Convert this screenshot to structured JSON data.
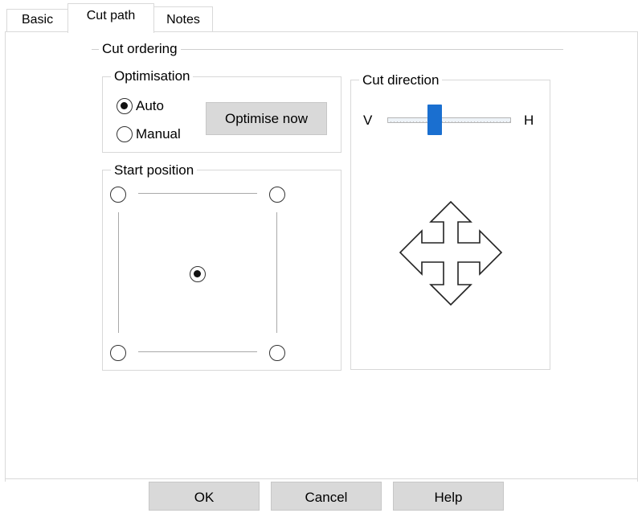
{
  "tabs": [
    {
      "label": "Basic"
    },
    {
      "label": "Cut path"
    },
    {
      "label": "Notes"
    }
  ],
  "cut_ordering": {
    "legend": "Cut ordering",
    "optimisation": {
      "legend": "Optimisation",
      "options": [
        {
          "label": "Auto",
          "checked": true
        },
        {
          "label": "Manual",
          "checked": false
        }
      ],
      "optimise_button": "Optimise now"
    },
    "start_position": {
      "legend": "Start position",
      "selected": "center"
    }
  },
  "cut_direction": {
    "legend": "Cut direction",
    "left_label": "V",
    "right_label": "H",
    "arrow_icon": "move-arrows-icon"
  },
  "buttons": {
    "ok": "OK",
    "cancel": "Cancel",
    "help": "Help"
  }
}
